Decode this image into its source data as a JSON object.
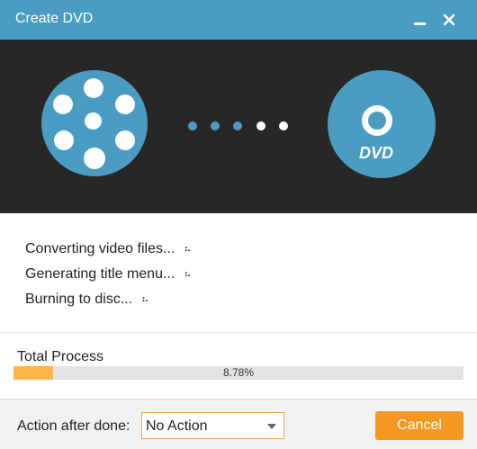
{
  "window": {
    "title": "Create DVD"
  },
  "steps": [
    {
      "label": "Converting video files..."
    },
    {
      "label": "Generating title menu..."
    },
    {
      "label": "Burning to disc..."
    }
  ],
  "progress": {
    "label": "Total Process",
    "percent_text": "8.78%",
    "percent": 8.78
  },
  "footer": {
    "action_label": "Action after done:",
    "action_value": "No Action",
    "cancel_label": "Cancel"
  },
  "disc": {
    "label": "DVD"
  },
  "colors": {
    "accent": "#4a9cc2",
    "hero_bg": "#272727",
    "progress_fill": "#fbb54a",
    "cancel_button": "#f5981f"
  }
}
